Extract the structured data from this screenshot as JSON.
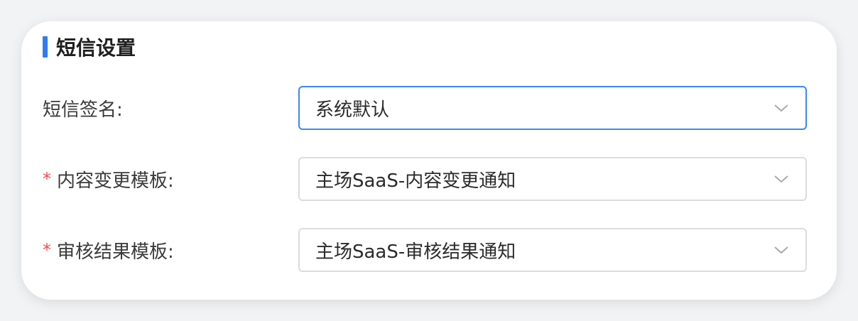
{
  "section": {
    "title": "短信设置"
  },
  "fields": [
    {
      "label": "短信签名:",
      "required": false,
      "value": "系统默认",
      "focused": true
    },
    {
      "label": "内容变更模板:",
      "required": true,
      "required_mark": "*",
      "value": "主场SaaS-内容变更通知",
      "focused": false
    },
    {
      "label": "审核结果模板:",
      "required": true,
      "required_mark": "*",
      "value": "主场SaaS-审核结果通知",
      "focused": false
    }
  ],
  "colors": {
    "accent": "#2f7cf6",
    "required": "#f24b4b",
    "focus_border": "#3d87f5",
    "border": "#d9dce1"
  },
  "icons": {
    "dropdown": "chevron-down-icon"
  }
}
